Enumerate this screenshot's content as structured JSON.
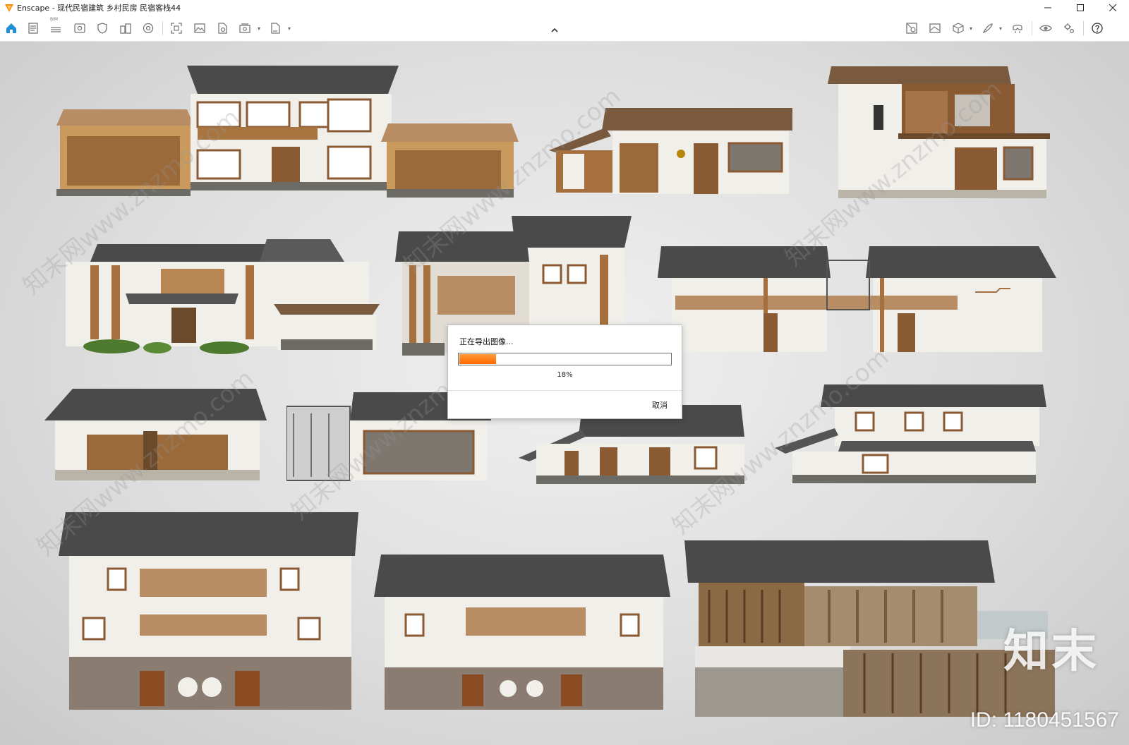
{
  "window": {
    "app_name": "Enscape",
    "separator": " - ",
    "file_title": "现代民宿建筑 乡村民房 民宿客栈44",
    "controls": [
      "minimize",
      "maximize",
      "close"
    ]
  },
  "toolbar": {
    "left_icons": [
      "home-icon",
      "document-icon",
      "bim-icon",
      "view-icon",
      "shield-icon",
      "buildings-icon",
      "sphere-icon",
      "screenshot-icon",
      "image-icon",
      "file-icon",
      "batch-render-icon",
      "export-exe-icon"
    ],
    "bim_label": "BIM",
    "collapse_icon": "chevron-up-icon",
    "right_icons": [
      "asset-library-icon",
      "visual-settings-icon",
      "cube-icon",
      "brush-icon",
      "vr-headset-icon",
      "eye-icon",
      "settings-icon",
      "help-icon"
    ]
  },
  "export_dialog": {
    "title": "正在导出图像...",
    "progress_percent": 18,
    "progress_label": "18%",
    "cancel_label": "取消",
    "accent": "#ff7a10"
  },
  "watermark": {
    "repeat_text": "知末网www.znzmo.com",
    "brand": "知末",
    "id_text": "ID: 1180451567"
  },
  "colors": {
    "roof_dark": "#4a4a4a",
    "wall_white": "#f1efea",
    "wood": "#8a5a32",
    "stone": "#6d6b66",
    "thatch": "#b98d64"
  }
}
